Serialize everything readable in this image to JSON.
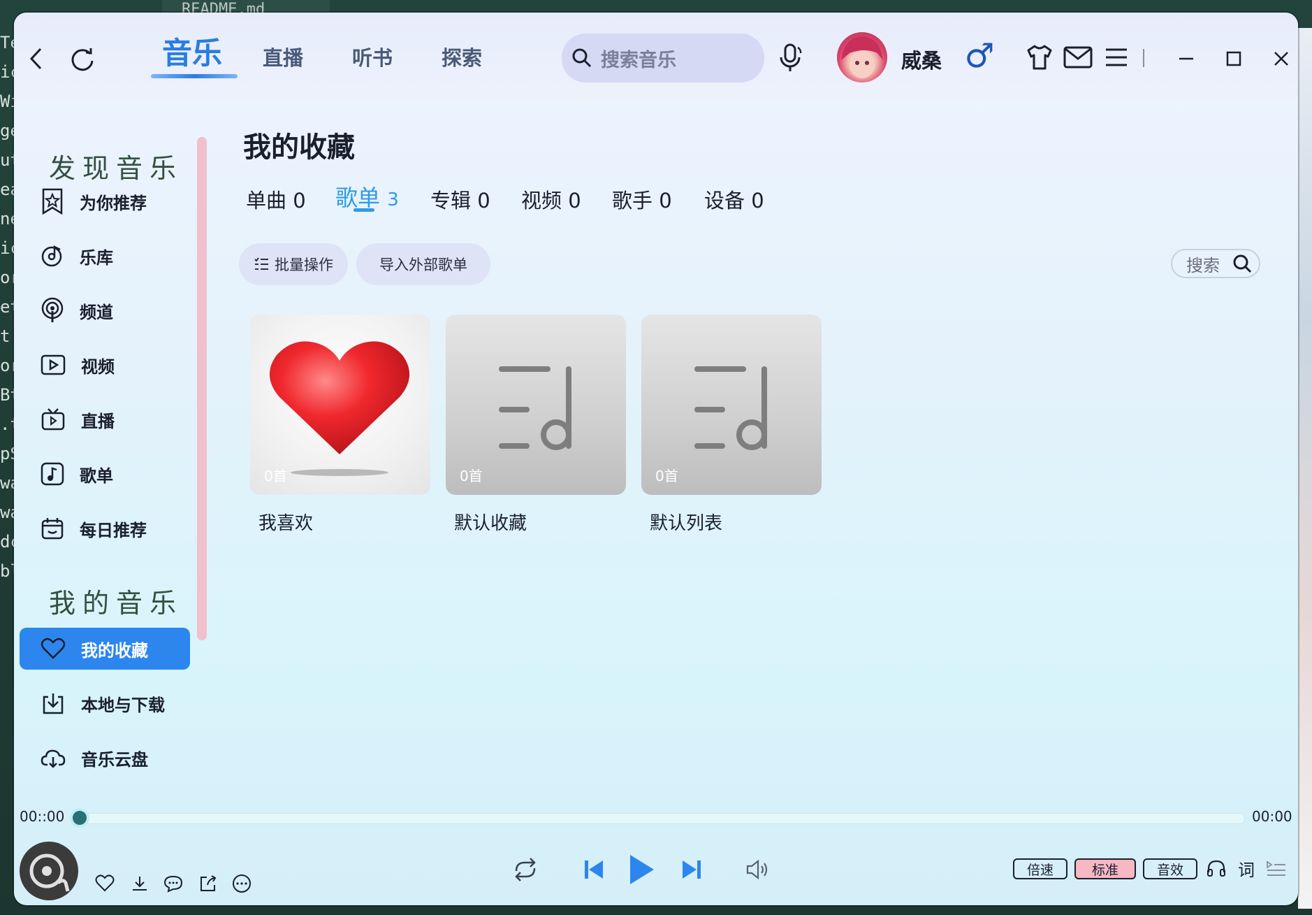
{
  "background": {
    "editor_tab": "README.md",
    "left_code_fragments": [
      "Te",
      "ic",
      "Wi",
      "ge",
      "ut",
      "ea",
      "ne",
      "ic",
      "or",
      "et",
      "t",
      "or",
      "Bt",
      ".t",
      "pS",
      "wa",
      "wa",
      "dc",
      "bl"
    ]
  },
  "topbar": {
    "tabs": [
      {
        "label": "音乐",
        "active": true
      },
      {
        "label": "直播",
        "active": false
      },
      {
        "label": "听书",
        "active": false
      },
      {
        "label": "探索",
        "active": false
      }
    ],
    "search_placeholder": "搜索音乐",
    "username": "威桑",
    "gender_symbol": "♂"
  },
  "sidebar": {
    "discover_title": "发现音乐",
    "discover_items": [
      {
        "label": "为你推荐",
        "icon": "star-bookmark-icon"
      },
      {
        "label": "乐库",
        "icon": "music-disc-icon"
      },
      {
        "label": "频道",
        "icon": "podcast-icon"
      },
      {
        "label": "视频",
        "icon": "video-icon"
      },
      {
        "label": "直播",
        "icon": "tv-icon"
      },
      {
        "label": "歌单",
        "icon": "music-note-icon"
      },
      {
        "label": "每日推荐",
        "icon": "calendar-icon"
      }
    ],
    "my_title": "我的音乐",
    "my_items": [
      {
        "label": "我的收藏",
        "icon": "heart-icon",
        "active": true
      },
      {
        "label": "本地与下载",
        "icon": "download-icon",
        "active": false
      },
      {
        "label": "音乐云盘",
        "icon": "cloud-icon",
        "active": false
      }
    ]
  },
  "main": {
    "title": "我的收藏",
    "sub_tabs": [
      {
        "label": "单曲",
        "count": "0",
        "active": false
      },
      {
        "label": "歌单",
        "count": "3",
        "active": true
      },
      {
        "label": "专辑",
        "count": "0",
        "active": false
      },
      {
        "label": "视频",
        "count": "0",
        "active": false
      },
      {
        "label": "歌手",
        "count": "0",
        "active": false
      },
      {
        "label": "设备",
        "count": "0",
        "active": false
      }
    ],
    "batch_button": "批量操作",
    "import_button": "导入外部歌单",
    "search_label": "搜索",
    "playlists": [
      {
        "name": "我喜欢",
        "count": "0首",
        "cover": "heart"
      },
      {
        "name": "默认收藏",
        "count": "0首",
        "cover": "playlist-icon"
      },
      {
        "name": "默认列表",
        "count": "0首",
        "cover": "playlist-icon"
      }
    ]
  },
  "player": {
    "current_time": "00::00",
    "total_time": "00:00",
    "progress": 0,
    "speed_label": "倍速",
    "quality_label": "标准",
    "effect_label": "音效",
    "lyrics_label": "词"
  },
  "colors": {
    "accent": "#2d86ee",
    "active_tab": "#2a7de0",
    "sidebar_scroll": "#f0c0cc",
    "quality_highlight": "#f7b7c3"
  }
}
